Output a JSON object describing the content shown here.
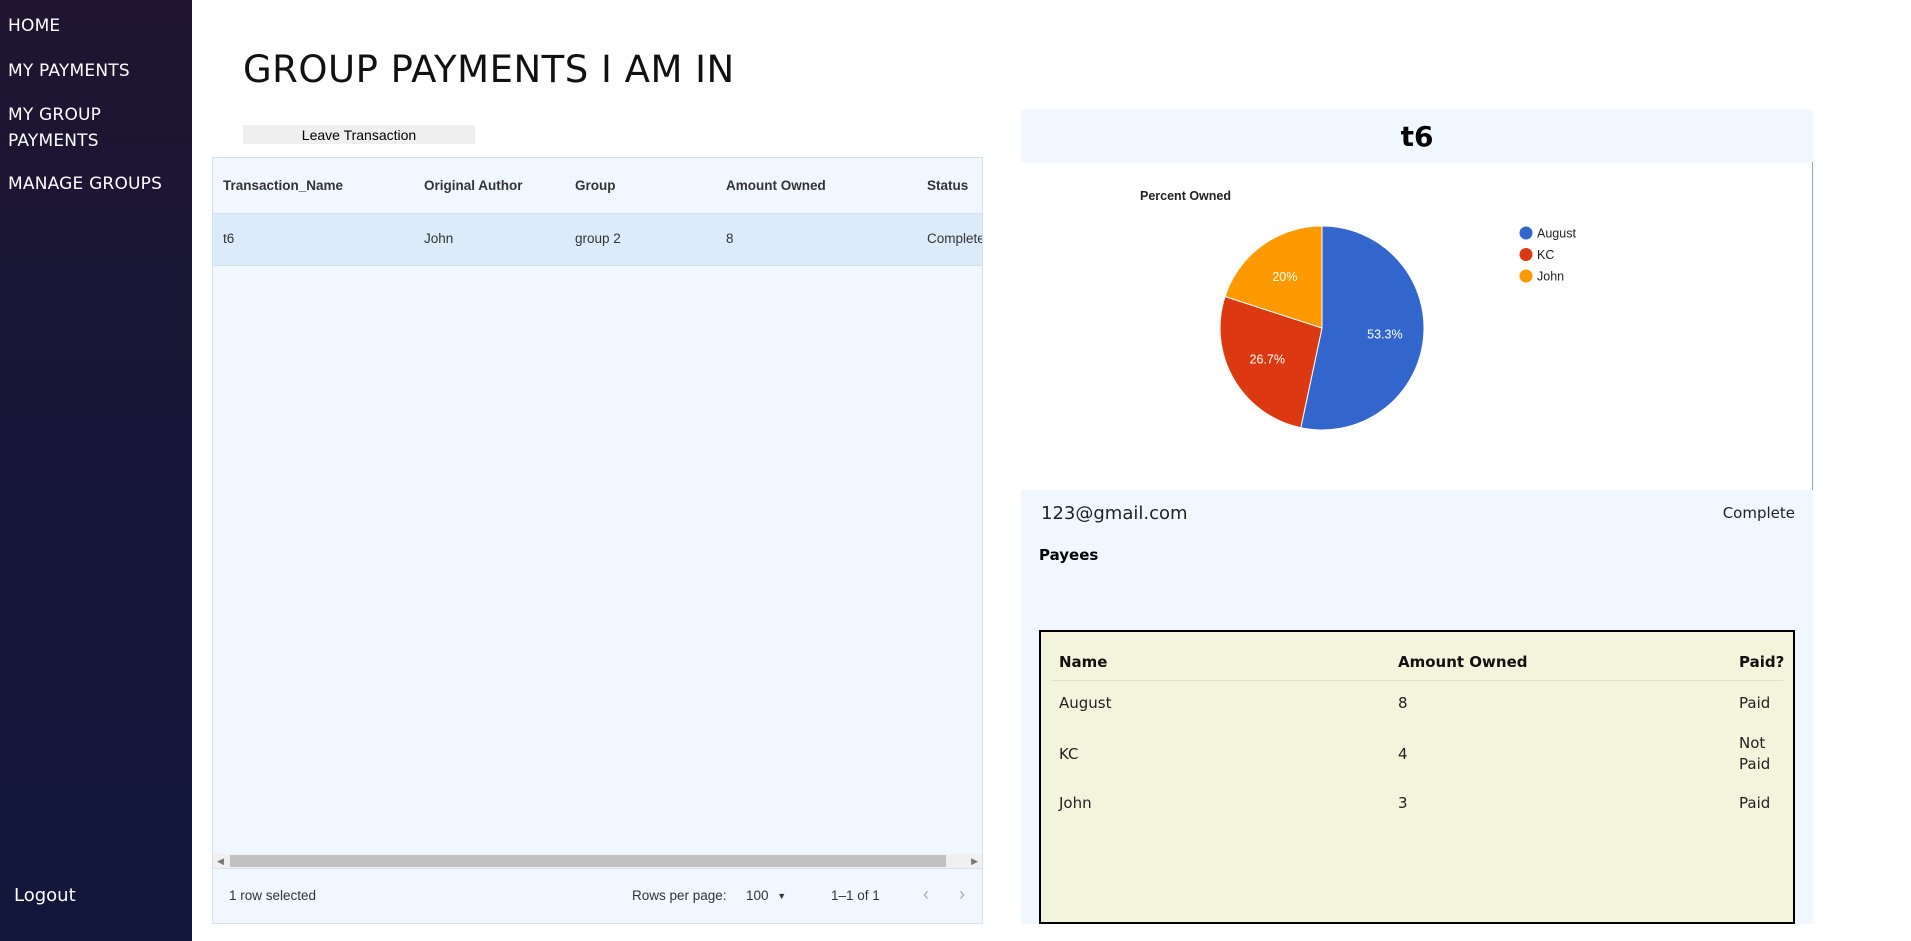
{
  "sidebar": {
    "items": [
      {
        "label": "HOME"
      },
      {
        "label": "MY PAYMENTS"
      },
      {
        "label": "MY GROUP PAYMENTS"
      },
      {
        "label": "MANAGE GROUPS"
      }
    ],
    "logout_label": "Logout"
  },
  "page": {
    "title": "GROUP PAYMENTS I AM IN",
    "leave_button_label": "Leave Transaction"
  },
  "grid": {
    "columns": [
      "Transaction_Name",
      "Original Author",
      "Group",
      "Amount Owned",
      "Status"
    ],
    "rows": [
      {
        "transaction_name": "t6",
        "original_author": "John",
        "group": "group 2",
        "amount_owned": "8",
        "status": "Complete"
      }
    ],
    "footer": {
      "selection_text": "1 row selected",
      "rows_per_page_label": "Rows per page:",
      "rows_per_page_value": "100",
      "pagination_text": "1–1 of 1"
    }
  },
  "detail": {
    "title": "t6",
    "email": "123@gmail.com",
    "status": "Complete",
    "payees_label": "Payees",
    "payee_table": {
      "headers": [
        "Name",
        "Amount Owned",
        "Paid?"
      ],
      "rows": [
        {
          "name": "August",
          "amount": "8",
          "paid": "Paid"
        },
        {
          "name": "KC",
          "amount": "4",
          "paid": "Not Paid"
        },
        {
          "name": "John",
          "amount": "3",
          "paid": "Paid"
        }
      ]
    }
  },
  "chart_data": {
    "type": "pie",
    "title": "Percent Owned",
    "legend_position": "right",
    "slices": [
      {
        "label": "August",
        "value": 8,
        "percent_label": "53.3%",
        "color": "#3366cc"
      },
      {
        "label": "KC",
        "value": 4,
        "percent_label": "26.7%",
        "color": "#dc3912"
      },
      {
        "label": "John",
        "value": 3,
        "percent_label": "20%",
        "color": "#ff9900"
      }
    ]
  }
}
